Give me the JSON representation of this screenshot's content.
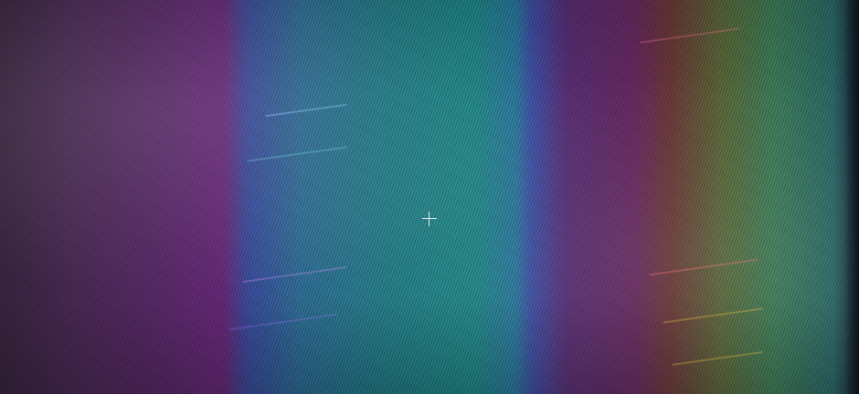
{
  "view": {
    "accent_colors": [
      "#6a2a7c",
      "#1f8a8a",
      "#3f4fa8",
      "#6d3a3a",
      "#5c6a3a",
      "#3f7f5a"
    ],
    "crosshair_icon": "crosshair-icon"
  }
}
